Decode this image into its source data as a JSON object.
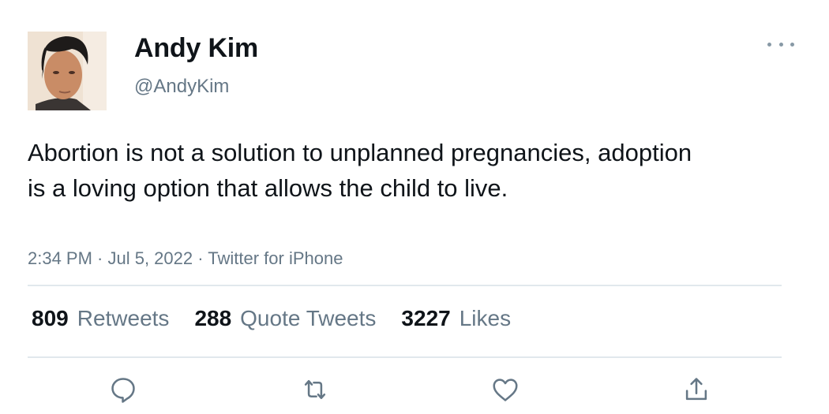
{
  "author": {
    "display_name": "Andy Kim",
    "handle": "@AndyKim"
  },
  "tweet": {
    "text": "Abortion is not a solution to unplanned pregnancies, adoption is a loving option that allows the child to live.",
    "meta": "2:34 PM · Jul 5, 2022 · Twitter for iPhone"
  },
  "stats": {
    "retweets_count": "809",
    "retweets_label": "Retweets",
    "quotes_count": "288",
    "quotes_label": "Quote Tweets",
    "likes_count": "3227",
    "likes_label": "Likes"
  },
  "icons": {
    "more": "more-icon",
    "reply": "reply-icon",
    "retweet": "retweet-icon",
    "like": "heart-icon",
    "share": "share-icon"
  },
  "colors": {
    "text": "#0f1419",
    "secondary": "#657786",
    "divider": "#e1e8ed"
  }
}
